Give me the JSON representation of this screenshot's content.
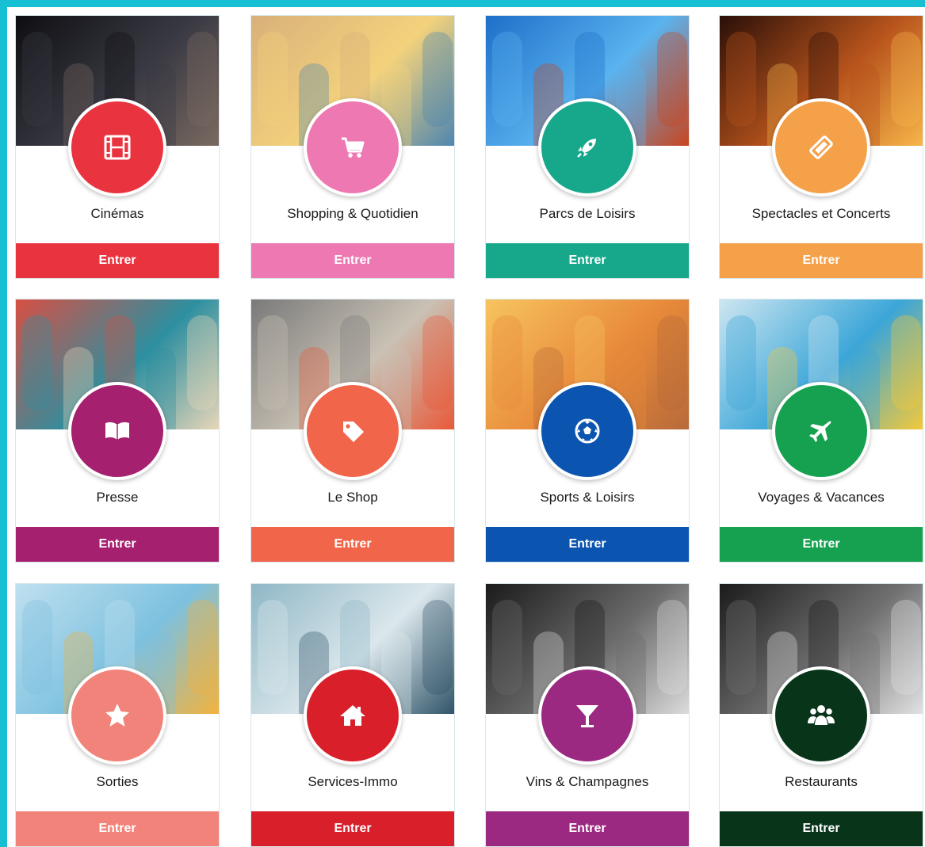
{
  "cards": [
    {
      "title": "Cinémas",
      "button": "Entrer",
      "color": "#e93440",
      "icon": "film-icon",
      "photo": [
        "#0e0e12",
        "#3a3a44",
        "#7a6a60"
      ]
    },
    {
      "title": "Shopping & Quotidien",
      "button": "Entrer",
      "color": "#ee78b2",
      "icon": "cart-icon",
      "photo": [
        "#d8b07a",
        "#f3d27c",
        "#4e86b0"
      ]
    },
    {
      "title": "Parcs de Loisirs",
      "button": "Entrer",
      "color": "#17a88c",
      "icon": "rocket-icon",
      "photo": [
        "#1e6fc9",
        "#5ab3ef",
        "#c8451f"
      ]
    },
    {
      "title": "Spectacles et Concerts",
      "button": "Entrer",
      "color": "#f4a14a",
      "icon": "ticket-icon",
      "photo": [
        "#2a0f08",
        "#b8541c",
        "#f7b54a"
      ]
    },
    {
      "title": "Presse",
      "button": "Entrer",
      "color": "#a5206e",
      "icon": "book-icon",
      "photo": [
        "#d84f43",
        "#2d8fa0",
        "#e8d6b8"
      ]
    },
    {
      "title": "Le Shop",
      "button": "Entrer",
      "color": "#f1654b",
      "icon": "tag-icon",
      "photo": [
        "#7a7a7a",
        "#c9c1b4",
        "#e85a3a"
      ]
    },
    {
      "title": "Sports & Loisirs",
      "button": "Entrer",
      "color": "#0b55b1",
      "icon": "football-icon",
      "photo": [
        "#f7c45f",
        "#e88a3a",
        "#b86a3a"
      ]
    },
    {
      "title": "Voyages & Vacances",
      "button": "Entrer",
      "color": "#15a150",
      "icon": "plane-icon",
      "photo": [
        "#cde6f1",
        "#3ba6d8",
        "#f3c93a"
      ]
    },
    {
      "title": "Sorties",
      "button": "Entrer",
      "color": "#f2837a",
      "icon": "star-icon",
      "photo": [
        "#bfe0ef",
        "#7dc1df",
        "#f2b33e"
      ]
    },
    {
      "title": "Services-Immo",
      "button": "Entrer",
      "color": "#d91f2a",
      "icon": "home-icon",
      "photo": [
        "#8fb7c6",
        "#dbe7ec",
        "#305468"
      ]
    },
    {
      "title": "Vins & Champagnes",
      "button": "Entrer",
      "color": "#9b2981",
      "icon": "cocktail-icon",
      "photo": [
        "#1b1b1b",
        "#6b6b6b",
        "#dcdcdc"
      ]
    },
    {
      "title": "Restaurants",
      "button": "Entrer",
      "color": "#08351a",
      "icon": "group-icon",
      "photo": [
        "#1b1b1b",
        "#707070",
        "#e2e2e2"
      ]
    }
  ]
}
